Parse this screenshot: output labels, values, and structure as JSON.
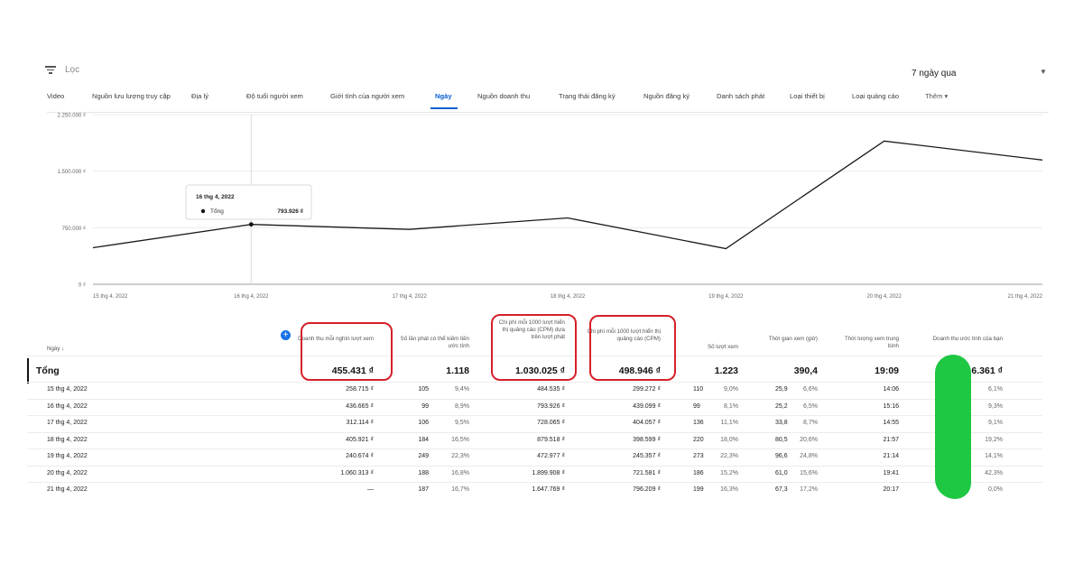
{
  "filter": {
    "label": "Lọc",
    "icon": "filter-icon"
  },
  "date_range": {
    "label": "7 ngày qua",
    "icon": "caret-down-icon"
  },
  "tabs": [
    {
      "label": "Video"
    },
    {
      "label": "Nguồn lưu lượng truy cập"
    },
    {
      "label": "Địa lý"
    },
    {
      "label": "Độ tuổi người xem"
    },
    {
      "label": "Giới tính của người xem"
    },
    {
      "label": "Ngày",
      "active": true
    },
    {
      "label": "Nguồn doanh thu"
    },
    {
      "label": "Trạng thái đăng ký"
    },
    {
      "label": "Nguồn đăng ký"
    },
    {
      "label": "Danh sách phát"
    },
    {
      "label": "Loại thiết bị"
    },
    {
      "label": "Loại quảng cáo"
    },
    {
      "label": "Thêm ▾"
    }
  ],
  "chart_data": {
    "type": "line",
    "x": [
      "15 thg 4, 2022",
      "16 thg 4, 2022",
      "17 thg 4, 2022",
      "18 thg 4, 2022",
      "19 thg 4, 2022",
      "20 thg 4, 2022",
      "21 thg 4, 2022"
    ],
    "series": [
      {
        "name": "Tổng",
        "values": [
          484535,
          793926,
          728065,
          879518,
          472977,
          1899908,
          1647769
        ]
      }
    ],
    "y_ticks": [
      "0 ₫",
      "750.000 ₫",
      "1.500.000 ₫",
      "2.250.000 ₫"
    ],
    "ylim": [
      0,
      2250000
    ],
    "grid": true,
    "tooltip": {
      "date": "16 thg 4, 2022",
      "label": "Tổng",
      "value": "793.926 ₫"
    }
  },
  "table": {
    "headers": {
      "date": "Ngày ↓",
      "rpm": "Doanh thu mỗi nghìn lượt xem",
      "monetized": "Số lần phát có thể kiếm tiền ước tính",
      "playback_cpm": "Chi phí mỗi 1000 lượt hiển thị quảng cáo (CPM) dựa trên lượt phát",
      "cpm": "Chi phí mỗi 1000 lượt hiển thị quảng cáo (CPM)",
      "views": "Số lượt xem",
      "watch": "Thời gian xem (giờ)",
      "avg": "Thời lượng xem trung bình",
      "revenue": "Doanh thu ước tính của bạn"
    },
    "add_column_icon": "plus-icon",
    "total": {
      "label": "Tổng",
      "rpm": "455.431 ₫",
      "monetized": "1.118",
      "playback_cpm": "1.030.025 ₫",
      "cpm": "498.946 ₫",
      "views": "1.223",
      "watch": "390,4",
      "avg": "19:09",
      "revenue": "6.361 ₫"
    },
    "rows": [
      {
        "date": "15 thg 4, 2022",
        "rpm": "258.715 ₫",
        "mon": "105",
        "mon_pct": "9,4%",
        "pcpm": "484.535 ₫",
        "cpm": "299.272 ₫",
        "views": "110",
        "views_pct": "9,0%",
        "watch": "25,9",
        "watch_pct": "6,6%",
        "avg": "14:06",
        "rev_pct": "6,1%"
      },
      {
        "date": "16 thg 4, 2022",
        "rpm": "436.665 ₫",
        "mon": "99",
        "mon_pct": "8,9%",
        "pcpm": "793.926 ₫",
        "cpm": "439.099 ₫",
        "views": "99",
        "views_pct": "8,1%",
        "watch": "25,2",
        "watch_pct": "6,5%",
        "avg": "15:16",
        "rev_pct": "9,3%"
      },
      {
        "date": "17 thg 4, 2022",
        "rpm": "312.114 ₫",
        "mon": "106",
        "mon_pct": "9,5%",
        "pcpm": "728.065 ₫",
        "cpm": "404.057 ₫",
        "views": "136",
        "views_pct": "11,1%",
        "watch": "33,8",
        "watch_pct": "8,7%",
        "avg": "14:55",
        "rev_pct": "9,1%"
      },
      {
        "date": "18 thg 4, 2022",
        "rpm": "405.921 ₫",
        "mon": "184",
        "mon_pct": "16,5%",
        "pcpm": "879.518 ₫",
        "cpm": "398.599 ₫",
        "views": "220",
        "views_pct": "18,0%",
        "watch": "80,5",
        "watch_pct": "20,6%",
        "avg": "21:57",
        "rev_pct": "19,2%"
      },
      {
        "date": "19 thg 4, 2022",
        "rpm": "240.674 ₫",
        "mon": "249",
        "mon_pct": "22,3%",
        "pcpm": "472.977 ₫",
        "cpm": "245.357 ₫",
        "views": "273",
        "views_pct": "22,3%",
        "watch": "96,6",
        "watch_pct": "24,8%",
        "avg": "21:14",
        "rev_pct": "14,1%"
      },
      {
        "date": "20 thg 4, 2022",
        "rpm": "1.060.313 ₫",
        "mon": "188",
        "mon_pct": "16,8%",
        "pcpm": "1.899.908 ₫",
        "cpm": "721.581 ₫",
        "views": "186",
        "views_pct": "15,2%",
        "watch": "61,0",
        "watch_pct": "15,6%",
        "avg": "19:41",
        "rev_pct": "42,3%"
      },
      {
        "date": "21 thg 4, 2022",
        "rpm": "—",
        "mon": "187",
        "mon_pct": "16,7%",
        "pcpm": "1.647.769 ₫",
        "cpm": "796.209 ₫",
        "views": "199",
        "views_pct": "16,3%",
        "watch": "67,3",
        "watch_pct": "17,2%",
        "avg": "20:17",
        "rev_pct": "0,0%"
      }
    ]
  }
}
